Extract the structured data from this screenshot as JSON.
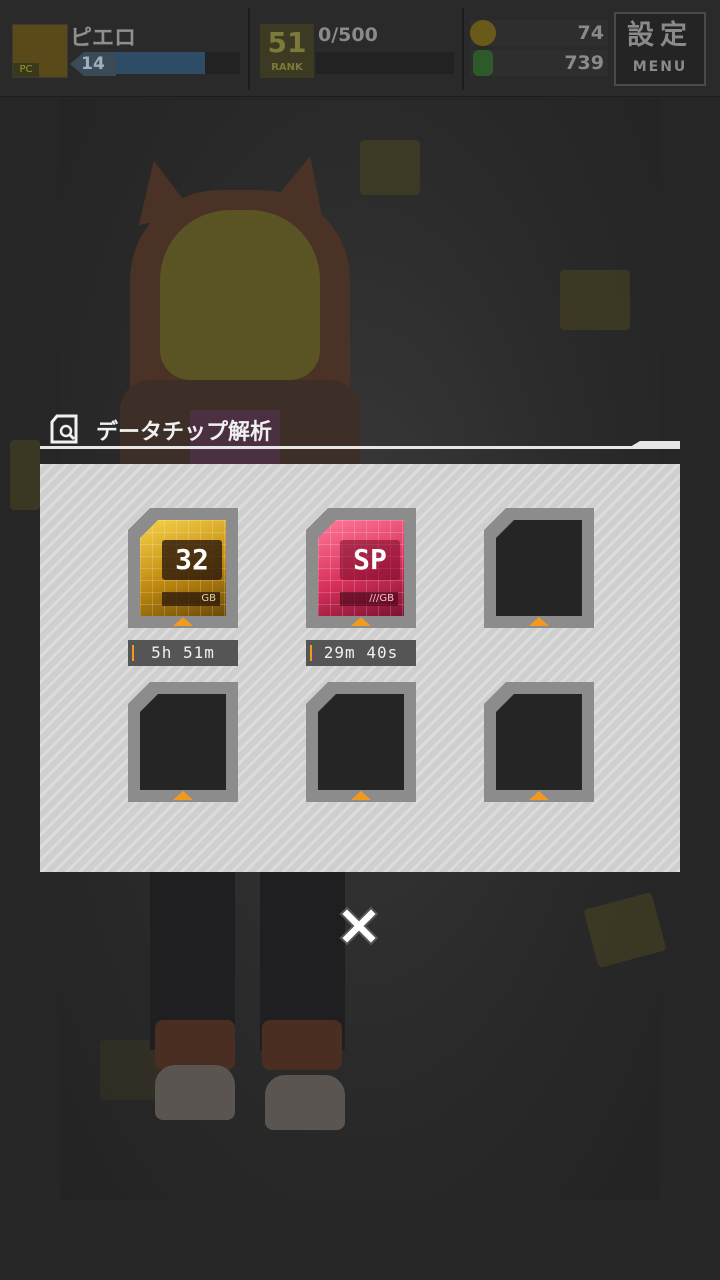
{
  "hud": {
    "player_name": "ピエロ",
    "avatar_tag": "PC",
    "level": "14",
    "level_progress": 0.72,
    "rank_value": "51",
    "rank_label": "RANK",
    "stamina_text": "0/500",
    "stamina_progress": 0.0,
    "coins": "74",
    "cans": "739",
    "menu_kanji": "設定",
    "menu_label": "MENU"
  },
  "dialog": {
    "title": "データチップ解析",
    "slots": [
      {
        "state": "chip",
        "chip_label": "32",
        "chip_unit": "GB",
        "chip_color": "#d4a41a",
        "timer": "5h 51m"
      },
      {
        "state": "chip",
        "chip_label": "SP",
        "chip_unit": "///GB",
        "chip_color": "#e03c64",
        "timer": "29m 40s"
      },
      {
        "state": "empty"
      },
      {
        "state": "empty"
      },
      {
        "state": "empty"
      },
      {
        "state": "empty"
      }
    ]
  },
  "colors": {
    "accent_orange": "#f39a1e",
    "panel": "#cfcfcf",
    "slot_frame": "#8c8c8c"
  },
  "icons": {
    "title_icon": "chip-analysis-icon",
    "close_icon": "close-icon"
  }
}
